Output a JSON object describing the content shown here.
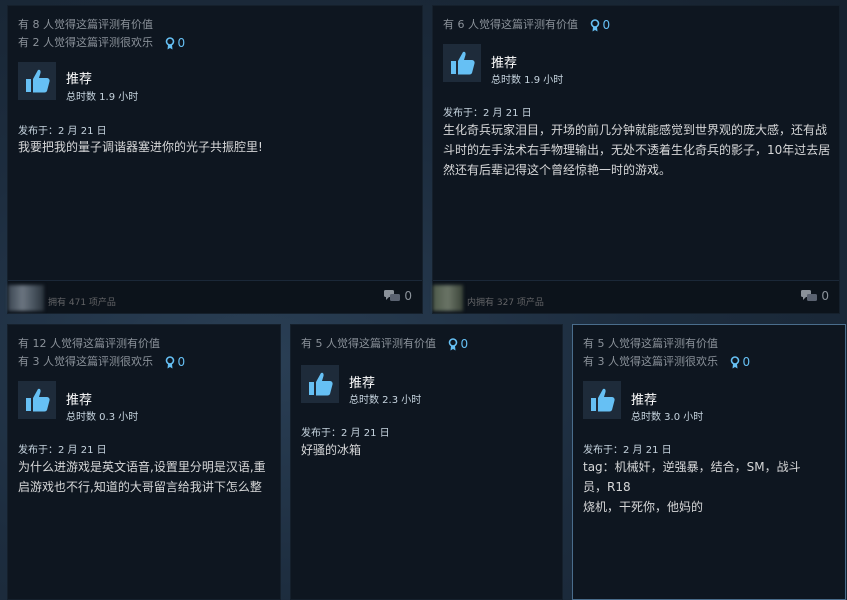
{
  "reviews": [
    {
      "helpful": "有 8 人觉得这篇评测有价值",
      "funny": "有 2 人觉得这篇评测很欢乐",
      "awards": "0",
      "recommend": "推荐",
      "hours": "总时数 1.9 小时",
      "posted": "发布于：2 月 21 日",
      "body": "我要把我的量子调谐器塞进你的光子共振腔里!",
      "owns": "拥有 471 项产品",
      "comments": "0"
    },
    {
      "helpful": "有 6 人觉得这篇评测有价值",
      "awards": "0",
      "recommend": "推荐",
      "hours": "总时数 1.9 小时",
      "posted": "发布于：2 月 21 日",
      "body": "生化奇兵玩家泪目，开场的前几分钟就能感觉到世界观的庞大感，还有战斗时的左手法术右手物理输出，无处不透着生化奇兵的影子，10年过去居然还有后辈记得这个曾经惊艳一时的游戏。",
      "owns": "内拥有 327 项产品",
      "comments": "0"
    },
    {
      "helpful": "有 12 人觉得这篇评测有价值",
      "funny": "有 3 人觉得这篇评测很欢乐",
      "awards": "0",
      "recommend": "推荐",
      "hours": "总时数 0.3 小时",
      "posted": "发布于：2 月 21 日",
      "body": "为什么进游戏是英文语音,设置里分明是汉语,重启游戏也不行,知道的大哥留言给我讲下怎么整"
    },
    {
      "helpful": "有 5 人觉得这篇评测有价值",
      "awards": "0",
      "recommend": "推荐",
      "hours": "总时数 2.3 小时",
      "posted": "发布于：2 月 21 日",
      "body": "好骚的冰箱"
    },
    {
      "helpful": "有 5 人觉得这篇评测有价值",
      "funny": "有 3 人觉得这篇评测很欢乐",
      "awards": "0",
      "recommend": "推荐",
      "hours": "总时数 3.0 小时",
      "posted": "发布于：2 月 21 日",
      "body": "tag：机械奸，逆强暴，结合，SM，战斗员，R18",
      "body2": "烧机，干死你，他妈的"
    }
  ],
  "icons": {
    "award": "award-ribbon-icon",
    "thumb": "thumbs-up-icon",
    "comment": "comment-bubble-icon"
  },
  "colors": {
    "card_bg": "#0e1620",
    "accent": "#66c0f4",
    "highlight_border": "#4a6d8c"
  }
}
